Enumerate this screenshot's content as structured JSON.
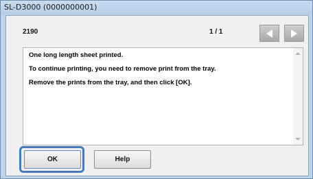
{
  "window": {
    "title": "SL-D3000 (0000000001)"
  },
  "header": {
    "code": "2190",
    "page_indicator": "1 / 1"
  },
  "message": {
    "lines": [
      "One long length sheet printed.",
      "To continue printing, you need to remove print from the tray.",
      "Remove the prints from the tray, and then click [OK]."
    ]
  },
  "buttons": {
    "ok": "OK",
    "help": "Help"
  },
  "icons": {
    "prev": "triangle-left-icon",
    "next": "triangle-right-icon"
  }
}
